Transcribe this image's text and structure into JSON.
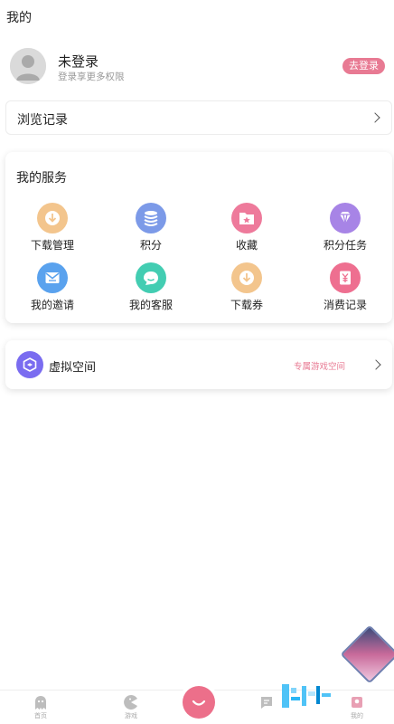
{
  "header": {
    "title": "我的"
  },
  "profile": {
    "name": "未登录",
    "subtitle": "登录享更多权限",
    "login_label": "去登录"
  },
  "history": {
    "label": "浏览记录"
  },
  "services": {
    "title": "我的服务",
    "items": [
      {
        "label": "下载管理",
        "icon": "download-icon",
        "color": "#f3c58d"
      },
      {
        "label": "积分",
        "icon": "coins-icon",
        "color": "#7c9ae8"
      },
      {
        "label": "收藏",
        "icon": "favorite-folder-icon",
        "color": "#ee7a9b"
      },
      {
        "label": "积分任务",
        "icon": "diamond-icon",
        "color": "#a784e6"
      },
      {
        "label": "我的邀请",
        "icon": "envelope-icon",
        "color": "#5aa2ee"
      },
      {
        "label": "我的客服",
        "icon": "chat-icon",
        "color": "#43cdb2"
      },
      {
        "label": "下载券",
        "icon": "download-coupon-icon",
        "color": "#f3c58d"
      },
      {
        "label": "消费记录",
        "icon": "yuan-receipt-icon",
        "color": "#ee6f90"
      }
    ]
  },
  "virtual": {
    "label": "虚拟空间",
    "tag": "专属游戏空间",
    "icon_color": "#7a6cf0"
  },
  "tabbar": {
    "items": [
      {
        "label": "首页",
        "icon": "ghost-icon"
      },
      {
        "label": "游戏",
        "icon": "pacman-icon"
      },
      {
        "label": "",
        "icon": "smile-icon"
      },
      {
        "label": "",
        "icon": "message-icon"
      },
      {
        "label": "我的",
        "icon": "profile-icon"
      }
    ]
  },
  "colors": {
    "accent": "#e87a93",
    "center": "#ec6f8a"
  }
}
